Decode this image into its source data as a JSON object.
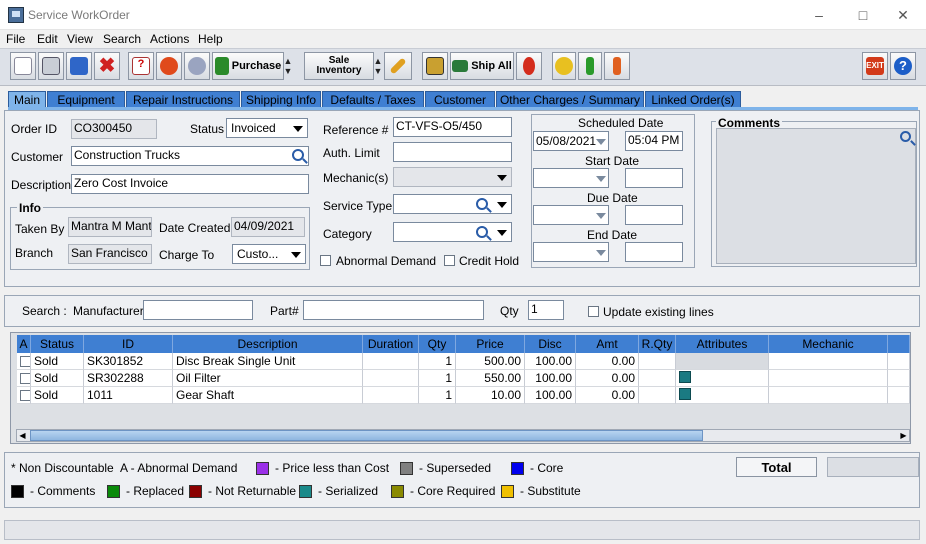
{
  "window": {
    "title": "Service WorkOrder"
  },
  "menu": [
    "File",
    "Edit",
    "View",
    "Search",
    "Actions",
    "Help"
  ],
  "toolbar": {
    "purchase_label": "Purchase",
    "sale_inventory_line1": "Sale",
    "sale_inventory_line2": "Inventory",
    "ship_all_label": "Ship All"
  },
  "tabs": [
    "Main",
    "Equipment",
    "Repair Instructions",
    "Shipping Info",
    "Defaults / Taxes",
    "Customer",
    "Other Charges / Summary",
    "Linked Order(s)"
  ],
  "main": {
    "order_id_label": "Order ID",
    "order_id": "CO300450",
    "status_label": "Status",
    "status": "Invoiced",
    "customer_label": "Customer",
    "customer": "Construction Trucks",
    "description_label": "Description",
    "description": "Zero Cost Invoice",
    "info_label": "Info",
    "taken_by_label": "Taken By",
    "taken_by": "Mantra M Mantra",
    "date_created_label": "Date Created",
    "date_created": "04/09/2021",
    "branch_label": "Branch",
    "branch": "San Francisco",
    "charge_to_label": "Charge To",
    "charge_to": "Custo...",
    "reference_label": "Reference #",
    "reference": "CT-VFS-O5/450",
    "auth_limit_label": "Auth. Limit",
    "auth_limit": "",
    "mechanics_label": "Mechanic(s)",
    "service_type_label": "Service Type",
    "category_label": "Category",
    "abnormal_demand_label": "Abnormal Demand",
    "credit_hold_label": "Credit Hold",
    "scheduled_date_label": "Scheduled Date",
    "scheduled_date": "05/08/2021",
    "scheduled_time": "05:04 PM",
    "start_date_label": "Start Date",
    "due_date_label": "Due Date",
    "end_date_label": "End Date",
    "comments_label": "Comments"
  },
  "search": {
    "search_label": "Search :",
    "manufacturer_label": "Manufacturer",
    "part_label": "Part#",
    "qty_label": "Qty",
    "qty": "1",
    "update_label": "Update existing lines"
  },
  "table": {
    "headers": [
      "A",
      "Status",
      "ID",
      "Description",
      "Duration",
      "Qty",
      "Price",
      "Disc",
      "Amt",
      "R.Qty",
      "Attributes",
      "Mechanic"
    ],
    "rows": [
      {
        "status": "Sold",
        "id": "SK301852",
        "description": "Disc Break Single Unit",
        "duration": "",
        "qty": "1",
        "price": "500.00",
        "disc": "100.00",
        "amt": "0.00",
        "rqty": "",
        "attr_swatch": false
      },
      {
        "status": "Sold",
        "id": "SR302288",
        "description": "Oil Filter",
        "duration": "",
        "qty": "1",
        "price": "550.00",
        "disc": "100.00",
        "amt": "0.00",
        "rqty": "",
        "attr_swatch": true
      },
      {
        "status": "Sold",
        "id": "1011",
        "description": "Gear Shaft",
        "duration": "",
        "qty": "1",
        "price": "10.00",
        "disc": "100.00",
        "amt": "0.00",
        "rqty": "",
        "attr_swatch": true
      }
    ]
  },
  "legend": {
    "non_discountable": "* Non Discountable",
    "abnormal_demand": "A - Abnormal Demand",
    "items": [
      {
        "label": "- Price less than Cost",
        "color": "#9b30e8"
      },
      {
        "label": "- Superseded",
        "color": "#808080"
      },
      {
        "label": "- Core",
        "color": "#0000ee"
      },
      {
        "label": "- Comments",
        "color": "#000000"
      },
      {
        "label": "- Replaced",
        "color": "#0a8a0a"
      },
      {
        "label": "- Not Returnable",
        "color": "#8b0000"
      },
      {
        "label": "- Serialized",
        "color": "#1a8a8a"
      },
      {
        "label": "- Core Required",
        "color": "#8a8a00"
      },
      {
        "label": "- Substitute",
        "color": "#f0c000"
      }
    ],
    "total_label": "Total",
    "total_value": ""
  },
  "colors": {
    "tab_blue": "#3f7fd2",
    "tab_active": "#7fb4ea",
    "header_blue": "#3f7fd2",
    "attr_teal": "#1a7a82"
  }
}
